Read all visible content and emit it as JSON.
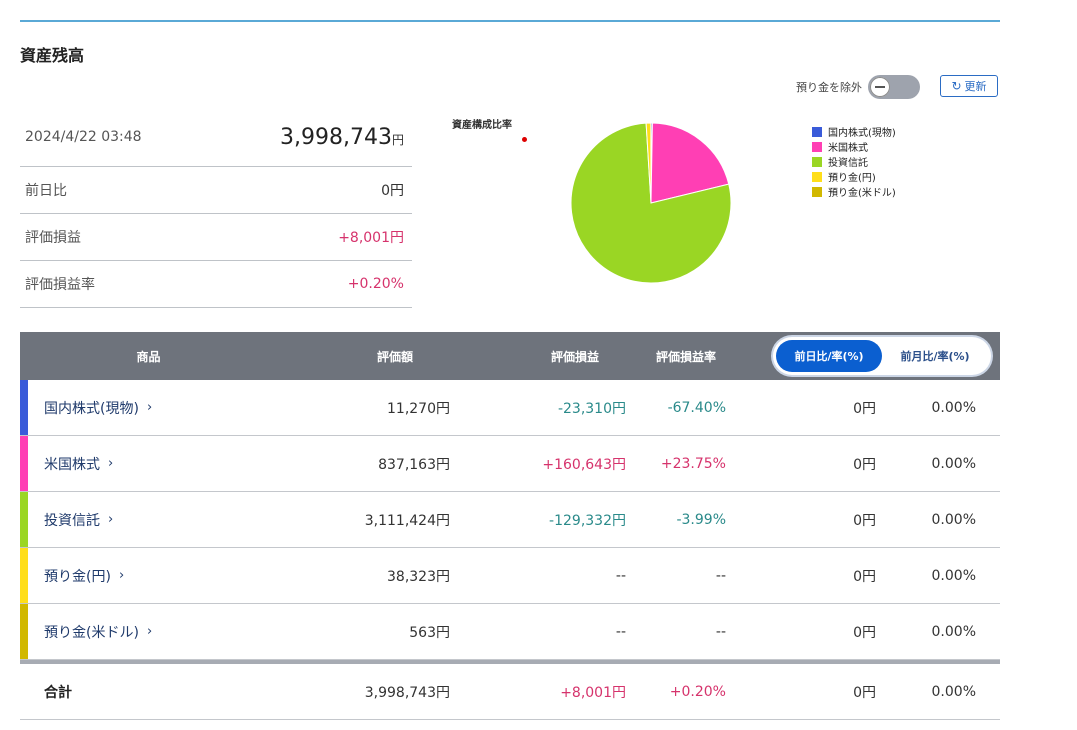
{
  "title": "資産残高",
  "controls": {
    "exclude_deposit_label": "預り金を除外",
    "refresh_label": "更新"
  },
  "summary": {
    "datetime": "2024/4/22 03:48",
    "total_value": "3,998,743",
    "total_unit": "円",
    "rows": [
      {
        "label": "前日比",
        "value": "0円"
      },
      {
        "label": "評価損益",
        "value": "+8,001円"
      },
      {
        "label": "評価損益率",
        "value": "+0.20%"
      }
    ]
  },
  "chart_data": {
    "type": "pie",
    "title": "資産構成比率",
    "categories": [
      "国内株式(現物)",
      "米国株式",
      "投資信託",
      "預り金(円)",
      "預り金(米ドル)"
    ],
    "values": [
      11270,
      837163,
      3111424,
      38323,
      563
    ],
    "colors": [
      "#3a5bd9",
      "#ff3fb4",
      "#9ad624",
      "#ffde1a",
      "#d1b800"
    ],
    "legend": "right"
  },
  "table": {
    "headers": {
      "name": "商品",
      "value": "評価額",
      "pl": "評価損益",
      "plr": "評価損益率",
      "seg_on": "前日比/率(%)",
      "seg_off": "前月比/率(%)"
    },
    "rows": [
      {
        "name": "国内株式(現物)",
        "value": "11,270円",
        "pl": "-23,310円",
        "plr": "-67.40%",
        "dd": "0円",
        "ddr": "0.00%",
        "color": "#3a5bd9",
        "sign": "neg"
      },
      {
        "name": "米国株式",
        "value": "837,163円",
        "pl": "+160,643円",
        "plr": "+23.75%",
        "dd": "0円",
        "ddr": "0.00%",
        "color": "#ff3fb4",
        "sign": "pos"
      },
      {
        "name": "投資信託",
        "value": "3,111,424円",
        "pl": "-129,332円",
        "plr": "-3.99%",
        "dd": "0円",
        "ddr": "0.00%",
        "color": "#9ad624",
        "sign": "neg"
      },
      {
        "name": "預り金(円)",
        "value": "38,323円",
        "pl": "--",
        "plr": "--",
        "dd": "0円",
        "ddr": "0.00%",
        "color": "#ffde1a",
        "sign": "none"
      },
      {
        "name": "預り金(米ドル)",
        "value": "563円",
        "pl": "--",
        "plr": "--",
        "dd": "0円",
        "ddr": "0.00%",
        "color": "#d1b800",
        "sign": "none"
      }
    ],
    "total": {
      "name": "合計",
      "value": "3,998,743円",
      "pl": "+8,001円",
      "plr": "+0.20%",
      "dd": "0円",
      "ddr": "0.00%"
    },
    "chevron": "›"
  }
}
